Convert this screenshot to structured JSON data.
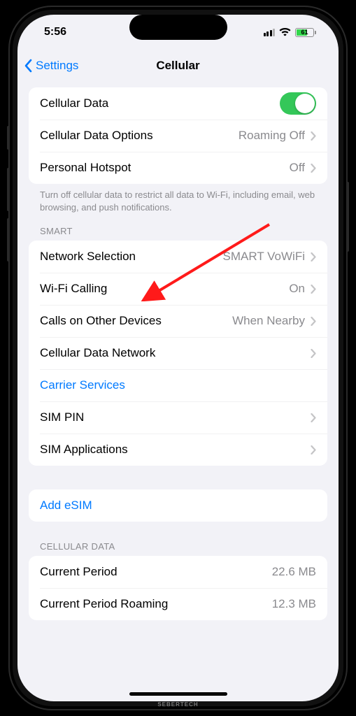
{
  "status": {
    "time": "5:56",
    "battery": "61"
  },
  "nav": {
    "back": "Settings",
    "title": "Cellular"
  },
  "g1": {
    "cellular_data": "Cellular Data",
    "options": "Cellular Data Options",
    "options_val": "Roaming Off",
    "hotspot": "Personal Hotspot",
    "hotspot_val": "Off",
    "footer": "Turn off cellular data to restrict all data to Wi-Fi, including email, web browsing, and push notifications."
  },
  "smart": {
    "header": "SMART",
    "nwsel": "Network Selection",
    "nwsel_val": "SMART VoWiFi",
    "wfc": "Wi-Fi Calling",
    "wfc_val": "On",
    "cod": "Calls on Other Devices",
    "cod_val": "When Nearby",
    "cdn": "Cellular Data Network",
    "cs": "Carrier Services",
    "pin": "SIM PIN",
    "apps": "SIM Applications"
  },
  "esim": {
    "add": "Add eSIM"
  },
  "usage": {
    "header": "CELLULAR DATA",
    "cp": "Current Period",
    "cp_val": "22.6 MB",
    "cpr": "Current Period Roaming",
    "cpr_val": "12.3 MB"
  },
  "wm": "SEBERTECH"
}
